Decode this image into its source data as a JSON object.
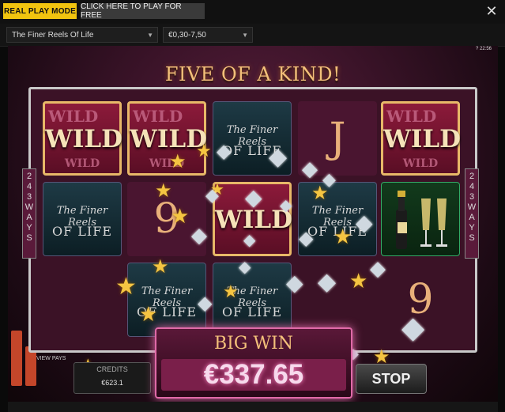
{
  "header": {
    "real_play_label": "REAL PLAY MODE",
    "free_play_label": "CLICK HERE TO PLAY FOR FREE",
    "close_glyph": "✕"
  },
  "selectors": {
    "game_name": "The Finer Reels Of Life",
    "bet_range": "€0,30-7,50",
    "arrow_glyph": "▼"
  },
  "game": {
    "hud_time": "22:56",
    "hud_help": "?",
    "headline": "FIVE OF A KIND!",
    "ways_left": [
      "2",
      "4",
      "3",
      "W",
      "A",
      "Y",
      "S"
    ],
    "ways_right": [
      "2",
      "4",
      "3",
      "W",
      "A",
      "Y",
      "S"
    ],
    "reels": {
      "wild_big": "WILD",
      "wild_small": "WILD",
      "logo_line1": "The Finer Reels",
      "logo_line2": "OF LIFE",
      "symbol_j": "J",
      "symbol_9": "9"
    },
    "big_win_title": "BIG WIN",
    "big_win_amount": "€337.65",
    "view_pays": "VIEW PAYS",
    "credits_label": "CREDITS",
    "credits_value": "€623.1",
    "stop_label": "STOP"
  },
  "colors": {
    "accent_yellow": "#f1c40f",
    "win_pink": "#e06aa8",
    "gold_text": "#f3c07a"
  },
  "icons": {
    "star": "★",
    "diamond": "◆"
  }
}
